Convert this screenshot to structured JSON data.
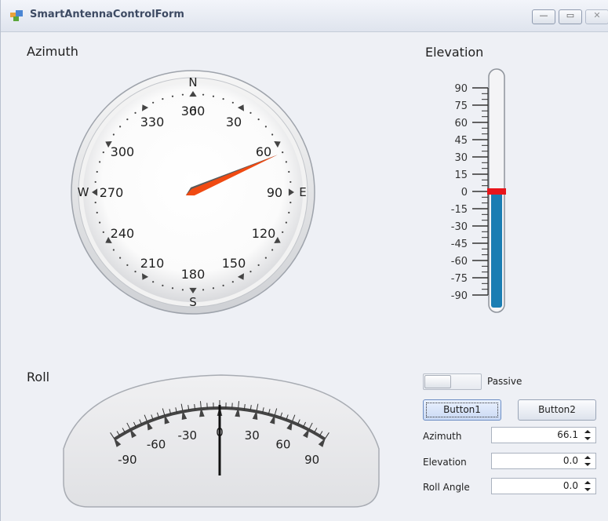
{
  "window": {
    "title": "SmartAntennaControlForm"
  },
  "azimuth_gauge": {
    "label": "Azimuth",
    "value": 66.1,
    "ticks": [
      "0",
      "30",
      "60",
      "90",
      "120",
      "150",
      "180",
      "210",
      "240",
      "270",
      "300",
      "330",
      "360"
    ],
    "cardinals": {
      "n": "N",
      "e": "E",
      "s": "S",
      "w": "W"
    },
    "needle_color": "#f04a12"
  },
  "elevation_gauge": {
    "label": "Elevation",
    "value": 0.0,
    "range": [
      -90,
      90
    ],
    "ticks": [
      "90",
      "75",
      "60",
      "45",
      "30",
      "15",
      "0",
      "-15",
      "-30",
      "-45",
      "-60",
      "-75",
      "-90"
    ],
    "fill_color": "#1a7db3",
    "marker_color": "#e8151b"
  },
  "roll_gauge": {
    "label": "Roll",
    "value": 0.0,
    "range": [
      -90,
      90
    ],
    "ticks": [
      "-90",
      "-60",
      "-30",
      "0",
      "30",
      "60",
      "90"
    ]
  },
  "controls": {
    "mode_toggle_label": "Passive",
    "button1_label": "Button1",
    "button2_label": "Button2",
    "fields": [
      {
        "label": "Azimuth",
        "value": "66.1"
      },
      {
        "label": "Elevation",
        "value": "0.0"
      },
      {
        "label": "Roll Angle",
        "value": "0.0"
      }
    ]
  }
}
